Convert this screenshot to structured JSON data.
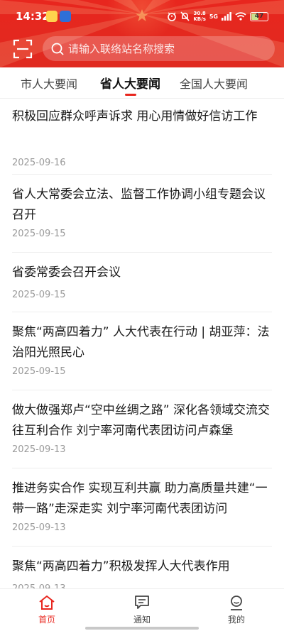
{
  "status_bar": {
    "time": "14:32",
    "net_speed_value": "30.8",
    "net_speed_unit": "KB/s",
    "signal_label": "5G",
    "battery": "47"
  },
  "search": {
    "placeholder": "请输入联络站名称搜索"
  },
  "tabs": [
    {
      "label": "市人大要闻"
    },
    {
      "label": "省人大要闻",
      "active": true
    },
    {
      "label": "全国人大要闻"
    }
  ],
  "news": [
    {
      "title": "积极回应群众呼声诉求 用心用情做好信访工作",
      "date": "2025-09-16"
    },
    {
      "title": "省人大常委会立法、监督工作协调小组专题会议召开",
      "date": "2025-09-15"
    },
    {
      "title": "省委常委会召开会议",
      "date": "2025-09-15"
    },
    {
      "title": "聚焦“两高四着力” 人大代表在行动 | 胡亚萍：法治阳光照民心",
      "date": "2025-09-15"
    },
    {
      "title": "做大做强郑卢“空中丝绸之路” 深化各领域交流交往互利合作 刘宁率河南代表团访问卢森堡",
      "date": "2025-09-13"
    },
    {
      "title": "推进务实合作 实现互利共赢 助力高质量共建“一带一路”走深走实 刘宁率河南代表团访问",
      "date": "2025-09-13"
    },
    {
      "title": "聚焦“两高四着力”积极发挥人大代表作用",
      "date": "2025-09-13"
    }
  ],
  "bottom_nav": [
    {
      "label": "首页",
      "icon": "home-icon",
      "active": true
    },
    {
      "label": "通知",
      "icon": "message-icon"
    },
    {
      "label": "我的",
      "icon": "profile-icon"
    }
  ],
  "colors": {
    "brand_red": "#e8261e",
    "date_gray": "#9a9a9a"
  }
}
